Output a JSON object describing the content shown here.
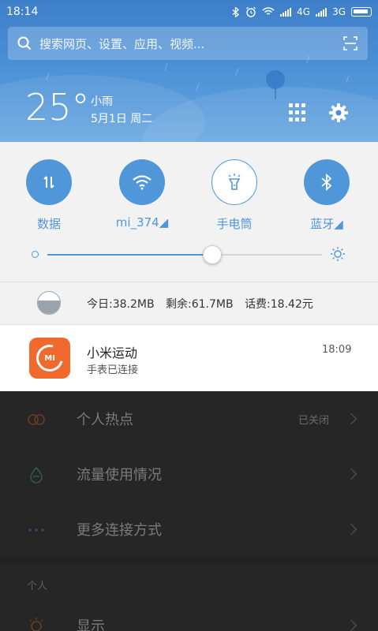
{
  "status_bar": {
    "time": "18:14",
    "network1": "4G",
    "network2": "3G"
  },
  "search": {
    "placeholder": "搜索网页、设置、应用、视频..."
  },
  "weather": {
    "temperature": "25°",
    "condition": "小雨",
    "date": "5月1日 周二"
  },
  "toggles": [
    {
      "label": "数据",
      "state": "on",
      "icon": "data-arrows-icon"
    },
    {
      "label": "mi_374◢",
      "state": "on",
      "icon": "wifi-icon"
    },
    {
      "label": "手电筒",
      "state": "off",
      "icon": "flashlight-icon"
    },
    {
      "label": "蓝牙◢",
      "state": "on",
      "icon": "bluetooth-icon"
    }
  ],
  "brightness": {
    "level": 0.6
  },
  "traffic": {
    "today": "今日:38.2MB",
    "remaining": "剩余:61.7MB",
    "fee": "话费:18.42元",
    "remaining_fraction": 0.62
  },
  "notification": {
    "app": "小米运动",
    "message": "手表已连接",
    "time": "18:09",
    "icon_text": "MI"
  },
  "settings": {
    "rows": [
      {
        "title": "个人热点",
        "value": "已关闭",
        "icon": "hotspot-icon"
      },
      {
        "title": "流量使用情况",
        "value": "",
        "icon": "data-usage-icon"
      },
      {
        "title": "更多连接方式",
        "value": "",
        "icon": "more-dots-icon"
      }
    ],
    "section_personal": "个人",
    "display": "显示"
  },
  "colors": {
    "accent": "#4f97d9",
    "app_icon": "#f06a2e"
  }
}
